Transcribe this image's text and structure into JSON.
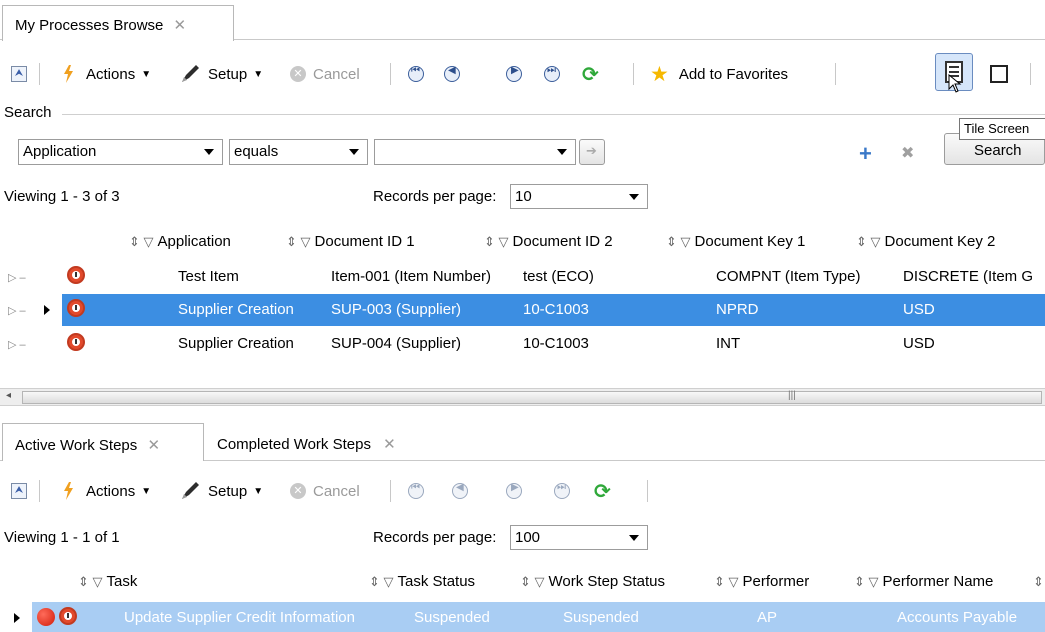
{
  "window": {
    "tab_title": "My Processes Browse"
  },
  "main_toolbar": {
    "actions_label": "Actions",
    "setup_label": "Setup",
    "cancel_label": "Cancel",
    "favorites_label": "Add to Favorites"
  },
  "tooltip": {
    "text": "Tile Screen"
  },
  "search": {
    "section_label": "Search",
    "field_value": "Application",
    "operator_value": "equals",
    "criteria_value": "",
    "search_button_label": "Search"
  },
  "top_grid": {
    "viewing_label": "Viewing 1 - 3 of 3",
    "records_per_page_label": "Records per page:",
    "records_per_page_value": "10",
    "columns": [
      "Application",
      "Document ID 1",
      "Document ID 2",
      "Document Key 1",
      "Document Key 2"
    ],
    "rows": [
      {
        "application": "Test Item",
        "doc_id_1": "Item-001 (Item Number)",
        "doc_id_2": "test (ECO)",
        "doc_key_1": "COMPNT (Item Type)",
        "doc_key_2": "DISCRETE (Item G",
        "selected": false
      },
      {
        "application": "Supplier Creation",
        "doc_id_1": "SUP-003 (Supplier)",
        "doc_id_2": "10-C1003",
        "doc_key_1": "NPRD",
        "doc_key_2": "USD",
        "selected": true
      },
      {
        "application": "Supplier Creation",
        "doc_id_1": "SUP-004 (Supplier)",
        "doc_id_2": "10-C1003",
        "doc_key_1": "INT",
        "doc_key_2": "USD",
        "selected": false
      }
    ],
    "scroll_grip": "|||"
  },
  "lower_tabs": {
    "active_label": "Active Work Steps",
    "completed_label": "Completed Work Steps"
  },
  "lower_toolbar": {
    "actions_label": "Actions",
    "setup_label": "Setup",
    "cancel_label": "Cancel"
  },
  "bottom_grid": {
    "viewing_label": "Viewing 1 - 1 of 1",
    "records_per_page_label": "Records per page:",
    "records_per_page_value": "100",
    "columns": [
      "Task",
      "Task Status",
      "Work Step Status",
      "Performer",
      "Performer Name"
    ],
    "rows": [
      {
        "task": "Update Supplier Credit Information",
        "task_status": "Suspended",
        "work_step_status": "Suspended",
        "performer": "AP",
        "performer_name": "Accounts Payable"
      }
    ]
  },
  "colors": {
    "selection": "#3c8ee2",
    "selection_light": "#b4d2f2",
    "add_icon": "#3a78c8"
  }
}
